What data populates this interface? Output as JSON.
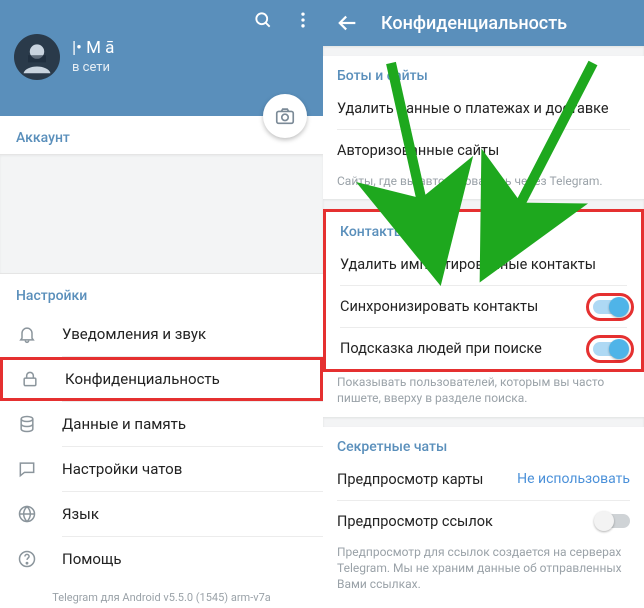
{
  "left": {
    "username": "|• M ā",
    "status": "в сети",
    "account_section": "Аккаунт",
    "settings_section": "Настройки",
    "items": [
      {
        "label": "Уведомления и звук"
      },
      {
        "label": "Конфиденциальность"
      },
      {
        "label": "Данные и память"
      },
      {
        "label": "Настройки чатов"
      },
      {
        "label": "Язык"
      },
      {
        "label": "Помощь"
      }
    ],
    "footer": "Telegram для Android v5.5.0 (1545) arm-v7a"
  },
  "right": {
    "title": "Конфиденциальность",
    "bots_section": "Боты и сайты",
    "bots_items": [
      "Удалить данные о платежах и доставке",
      "Авторизованные сайты"
    ],
    "bots_help": "Сайты, где вы авторизовались через Telegram.",
    "contacts_section": "Контакты",
    "contacts_items": [
      "Удалить импортированные контакты",
      "Синхронизировать контакты",
      "Подсказка людей при поиске"
    ],
    "contacts_help": "Показывать пользователей, которым вы часто пишете, вверху в разделе поиска.",
    "secret_section": "Секретные чаты",
    "secret_map": "Предпросмотр карты",
    "secret_map_value": "Не использовать",
    "secret_links": "Предпросмотр ссылок",
    "secret_help": "Предпросмотр для ссылок создается на серверах Telegram. Мы не храним данные об отправленных Вами ссылках."
  }
}
